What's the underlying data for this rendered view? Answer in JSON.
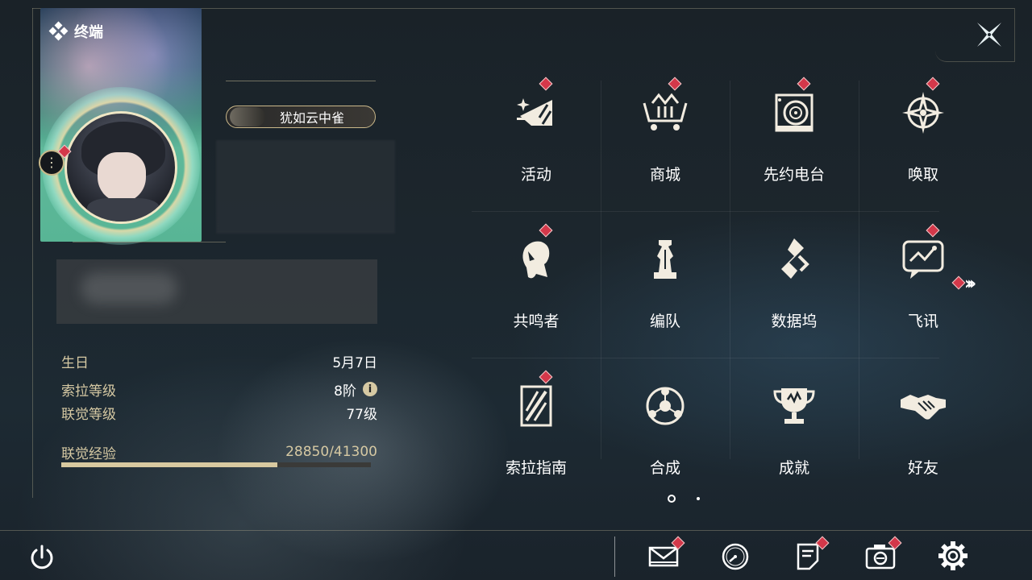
{
  "header": {
    "title": "终端",
    "close_icon": "close-x-icon"
  },
  "profile": {
    "player_name": "犹如云中雀",
    "menu_icon": "more-vertical-icon",
    "fields": [
      {
        "label": "生日",
        "value": "5月7日"
      },
      {
        "label": "索拉等级",
        "value": "8阶"
      },
      {
        "label": "联觉等级",
        "value": "77级"
      }
    ],
    "experience": {
      "label": "联觉经验",
      "value": "28850/41300",
      "fraction": 0.6985
    }
  },
  "menu": {
    "items": [
      {
        "label": "活动",
        "icon": "sparkle-activity-icon",
        "badge": true
      },
      {
        "label": "商城",
        "icon": "shop-cart-icon",
        "badge": true
      },
      {
        "label": "先约电台",
        "icon": "radio-icon",
        "badge": true
      },
      {
        "label": "唤取",
        "icon": "compass-icon",
        "badge": true
      },
      {
        "label": "共鸣者",
        "icon": "character-head-icon",
        "badge": true
      },
      {
        "label": "编队",
        "icon": "chess-piece-icon",
        "badge": false
      },
      {
        "label": "数据坞",
        "icon": "data-dock-icon",
        "badge": false
      },
      {
        "label": "飞讯",
        "icon": "chat-bubble-icon",
        "badge": true
      },
      {
        "label": "索拉指南",
        "icon": "guide-book-icon",
        "badge": true
      },
      {
        "label": "合成",
        "icon": "synthesis-icon",
        "badge": false
      },
      {
        "label": "成就",
        "icon": "trophy-icon",
        "badge": false
      },
      {
        "label": "好友",
        "icon": "handshake-icon",
        "badge": false
      }
    ],
    "next_page_icon": "double-chevron-right-icon",
    "pages": 2,
    "current_page": 1
  },
  "bottom_bar": {
    "power_icon": "power-icon",
    "actions": [
      {
        "name": "mail",
        "icon": "mail-icon",
        "badge": true
      },
      {
        "name": "clock",
        "icon": "clock-icon",
        "badge": false
      },
      {
        "name": "notice",
        "icon": "notice-icon",
        "badge": true
      },
      {
        "name": "camera",
        "icon": "camera-icon",
        "badge": true
      },
      {
        "name": "settings",
        "icon": "settings-gear-icon",
        "badge": false
      }
    ]
  },
  "colors": {
    "accent_gold": "#d6c9a3",
    "badge_red": "#d4384a",
    "text": "#ffffff"
  }
}
